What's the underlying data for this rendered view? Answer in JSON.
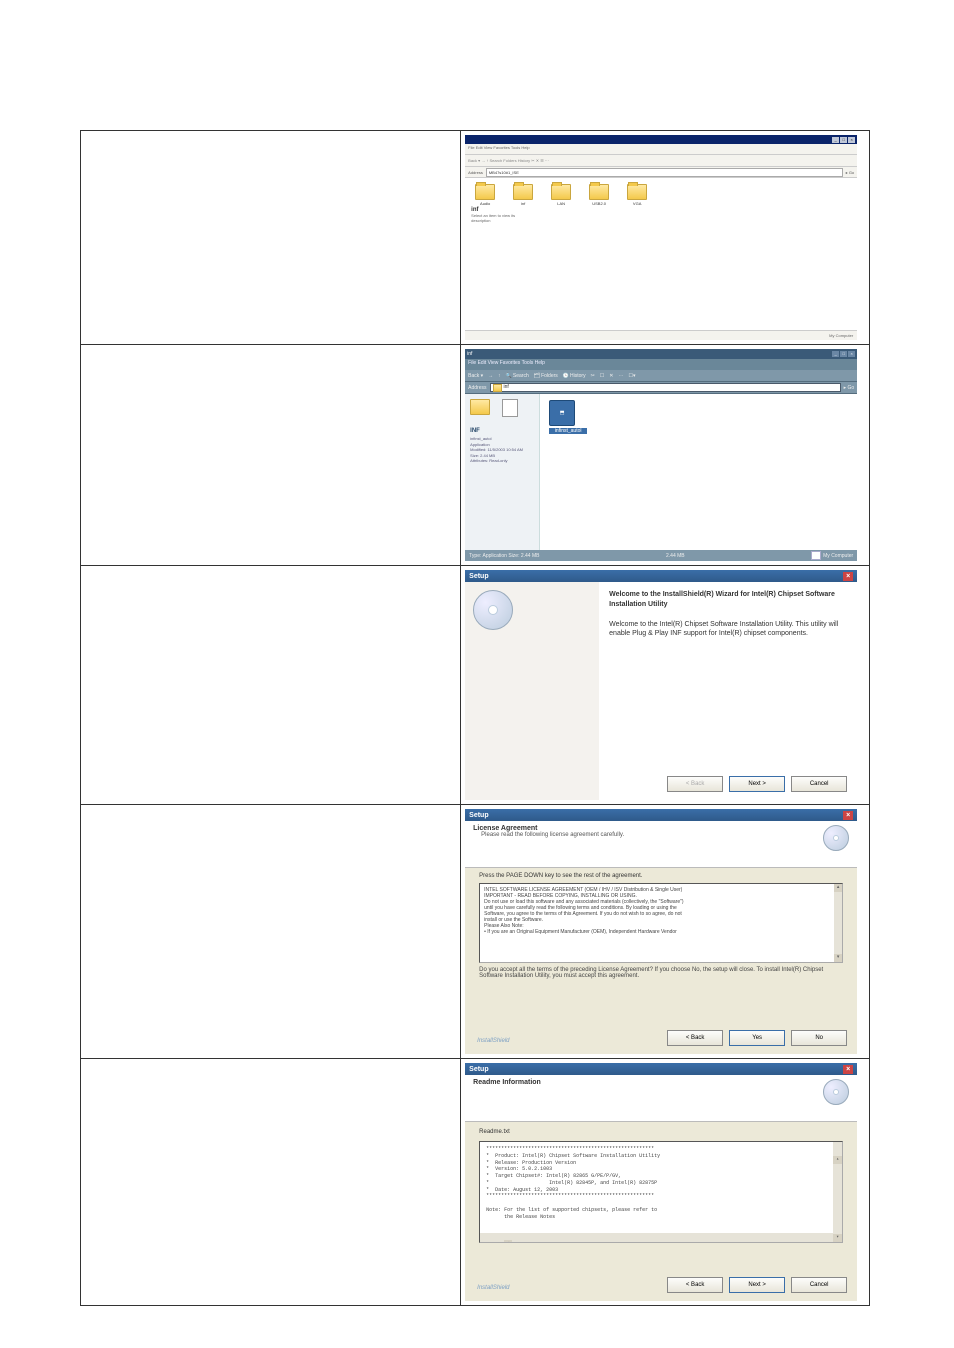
{
  "row1": {
    "title": "",
    "menu": "File  Edit  View  Favorites  Tools  Help",
    "toolbar": "Back  ▾   →   ↑   Search   Folders   History   ✂  ✕  ☰   ⋯",
    "address_label": "Address",
    "address_value": "MB47s10#1_ISE",
    "go": "Go",
    "folders": [
      "Audio",
      "inf",
      "LAN",
      "USB2.0",
      "VGA"
    ],
    "side_head": "inf",
    "side_sub1": "Select an item to view its",
    "side_sub2": "description",
    "status_right": "My Computer"
  },
  "row2": {
    "title": "inf",
    "menu": "File  Edit  View  Favorites  Tools  Help",
    "toolbar_items": [
      "Back ▾",
      "→",
      "↑",
      "Search",
      "Folders",
      "History",
      "✂",
      "☐",
      "✕",
      "⋯",
      "☐▾"
    ],
    "address_label": "Address",
    "address_value": "inf",
    "go": "Go",
    "app_name": "infinst_autol",
    "panel_head": "INF",
    "panel_lines": [
      "infinst_autol",
      "Application",
      "Modified: 11/5/2003 10:54 AM",
      "Size: 2.44 MB",
      "Attributes: Read-only"
    ],
    "status_left": "Type: Application  Size: 2.44 MB",
    "status_mid": "2.44 MB",
    "status_right": "My Computer"
  },
  "row3": {
    "title": "Setup",
    "heading": "Welcome to the InstallShield(R) Wizard for Intel(R) Chipset Software Installation Utility",
    "body": "Welcome to the Intel(R) Chipset Software Installation Utility.  This utility will enable Plug & Play INF support for Intel(R) chipset components.",
    "btn_back": "< Back",
    "btn_next": "Next >",
    "btn_cancel": "Cancel"
  },
  "row4": {
    "title": "Setup",
    "heading": "License Agreement",
    "sub": "Please read the following license agreement carefully.",
    "instruct": "Press the PAGE DOWN key to see the rest of the agreement.",
    "license_lines": [
      "INTEL SOFTWARE LICENSE AGREEMENT (OEM / IHV / ISV Distribution & Single User)",
      "",
      "IMPORTANT - READ BEFORE COPYING, INSTALLING OR USING.",
      "Do not use or load this software and any associated materials (collectively, the \"Software\")",
      "until you have carefully read the following terms and conditions. By loading or using the",
      "Software, you agree to the terms of this Agreement. If you do not wish to so agree, do not",
      "install or use the Software.",
      "",
      "Please Also Note:",
      "• If you are an Original Equipment Manufacturer (OEM), Independent Hardware Vendor"
    ],
    "accept": "Do you accept all the terms of the preceding License Agreement? If you choose No, the setup will close. To install Intel(R) Chipset Software Installation Utility, you must accept this agreement.",
    "brand": "InstallShield",
    "btn_back": "< Back",
    "btn_yes": "Yes",
    "btn_no": "No"
  },
  "row5": {
    "title": "Setup",
    "heading": "Readme Information",
    "label": "Readme.txt",
    "readme_lines": [
      "********************************************************",
      "*  Product: Intel(R) Chipset Software Installation Utility",
      "*  Release: Production Version",
      "*  Version: 5.0.2.1003",
      "*  Target Chipset#: Intel(R) 82865 G/PE/P/GV,",
      "*                    Intel(R) 82845P, and Intel(R) 82875P",
      "*  Date: August 12, 2003",
      "********************************************************",
      "",
      "Note: For the list of supported chipsets, please refer to",
      "      the Release Notes"
    ],
    "brand": "InstallShield",
    "btn_back": "< Back",
    "btn_next": "Next >",
    "btn_cancel": "Cancel"
  }
}
